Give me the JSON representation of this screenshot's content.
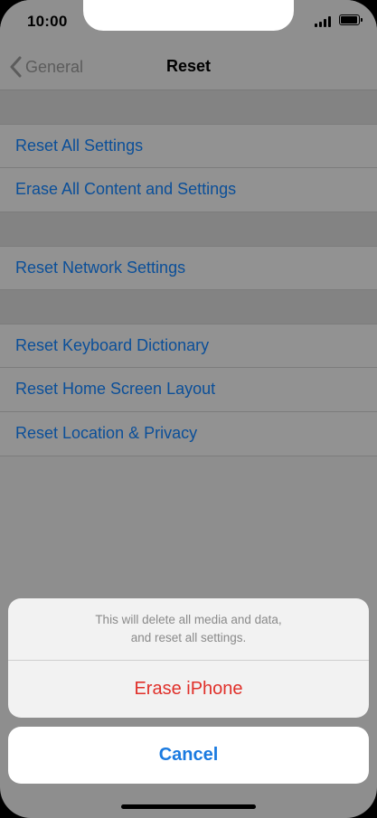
{
  "status_bar": {
    "time": "10:00"
  },
  "nav": {
    "back_label": "General",
    "title": "Reset"
  },
  "list": {
    "groups": [
      {
        "items": [
          {
            "label": "Reset All Settings"
          },
          {
            "label": "Erase All Content and Settings"
          }
        ]
      },
      {
        "items": [
          {
            "label": "Reset Network Settings"
          }
        ]
      },
      {
        "items": [
          {
            "label": "Reset Keyboard Dictionary"
          },
          {
            "label": "Reset Home Screen Layout"
          },
          {
            "label": "Reset Location & Privacy"
          }
        ]
      }
    ]
  },
  "action_sheet": {
    "message_line1": "This will delete all media and data,",
    "message_line2": "and reset all settings.",
    "destructive_label": "Erase iPhone",
    "cancel_label": "Cancel"
  },
  "colors": {
    "link": "#0b4f99",
    "destructive": "#e0302a",
    "cancel": "#1a7ae0"
  }
}
